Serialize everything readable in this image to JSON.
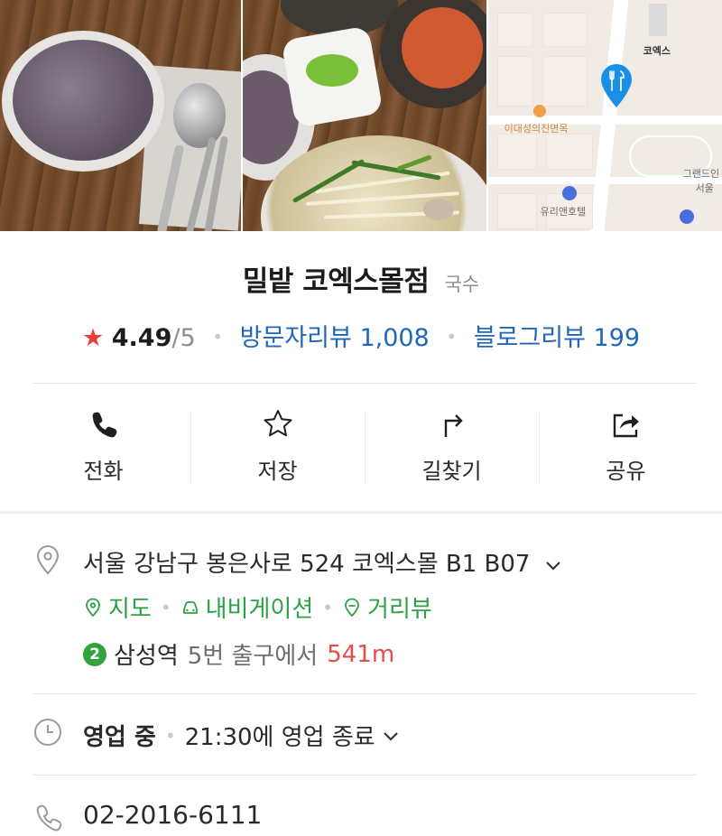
{
  "place": {
    "name": "밀밭 코엑스몰점",
    "category": "국수"
  },
  "rating": {
    "star": "★",
    "score": "4.49",
    "out_of": "/5",
    "visitor_reviews_label": "방문자리뷰",
    "visitor_reviews_count": "1,008",
    "blog_reviews_label": "블로그리뷰",
    "blog_reviews_count": "199"
  },
  "map": {
    "labels": {
      "coex": "코엑스",
      "restaurant": "이대성의진면목",
      "hotel": "유리앤호텔",
      "grand_line1": "그랜드인",
      "grand_line2": "서울"
    }
  },
  "actions": [
    {
      "label": "전화",
      "icon": "phone-icon"
    },
    {
      "label": "저장",
      "icon": "star-outline-icon"
    },
    {
      "label": "길찾기",
      "icon": "directions-icon"
    },
    {
      "label": "공유",
      "icon": "share-icon"
    }
  ],
  "address": {
    "text": "서울 강남구 봉은사로 524 코엑스몰 B1 B07",
    "links": [
      "지도",
      "내비게이션",
      "거리뷰"
    ]
  },
  "subway": {
    "line": "2",
    "station": "삼성역",
    "exit": "5번 출구에서",
    "distance": "541m"
  },
  "hours": {
    "status": "영업 중",
    "closing": "21:30에 영업 종료"
  },
  "phone": "02-2016-6111",
  "colors": {
    "star": "#ec3d3d",
    "link_blue": "#2266bb",
    "green": "#2ba245",
    "distance_red": "#e94b4b",
    "pin_blue": "#1a8fe8",
    "line2_green": "#33a23d"
  }
}
